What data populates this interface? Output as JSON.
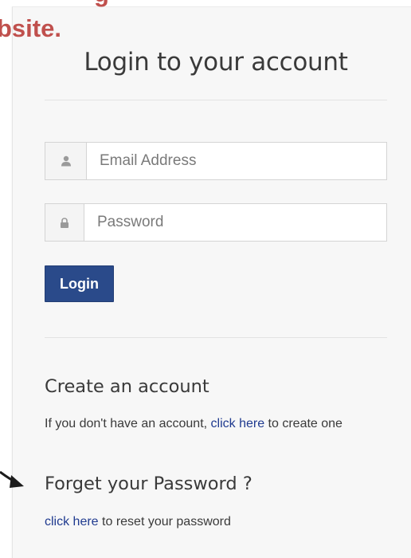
{
  "annotation": {
    "caption_top": "g",
    "caption": "bsite.",
    "caption_color": "#c0504d"
  },
  "login": {
    "title": "Login to your account",
    "email_placeholder": "Email Address",
    "password_placeholder": "Password",
    "email_icon": "user-icon",
    "password_icon": "lock-icon",
    "button_label": "Login",
    "button_color": "#2a4a8a"
  },
  "create_account": {
    "title": "Create an account",
    "text_before": "If you don't have an account, ",
    "link": "click here",
    "text_after": " to create one"
  },
  "forgot_password": {
    "title": "Forget your Password ?",
    "link": "click here",
    "text_after": " to reset your password"
  },
  "link_color": "#1f3a8f"
}
